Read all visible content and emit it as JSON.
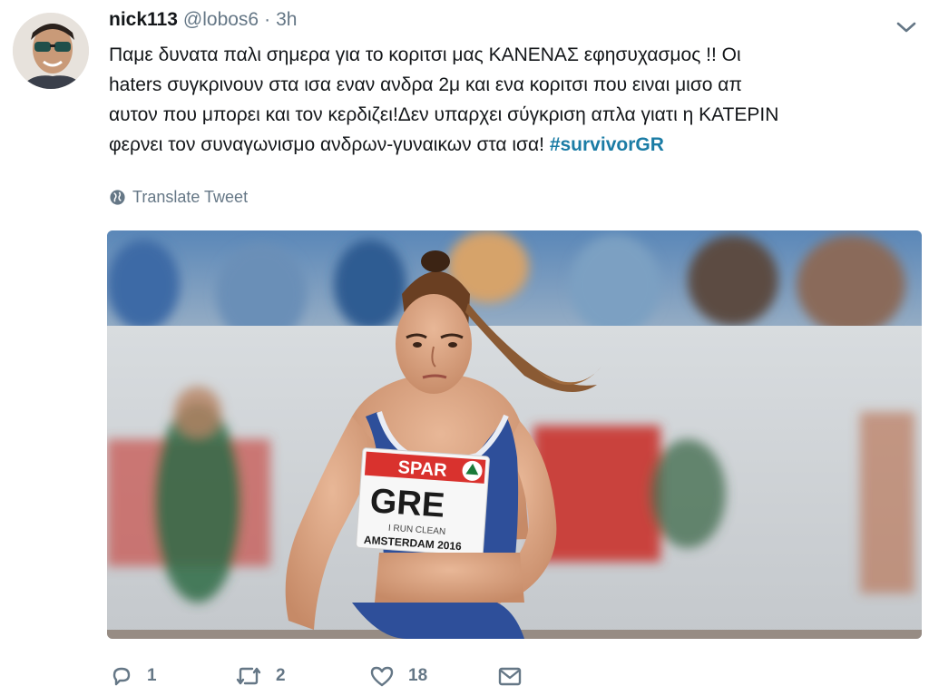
{
  "tweet": {
    "author_name": "nick113",
    "author_handle": "@lobos6",
    "separator": "·",
    "timestamp": "3h",
    "text_lines": [
      "Παμε δυνατα παλι σημερα για το κοριτσι μας ΚΑΝΕΝΑΣ εφησυχασμος !! Οι",
      "haters συγκρινουν στα ισα εναν ανδρα 2μ και ενα κοριτσι που ειναι μισο απ",
      "αυτον που μπορει και τον κερδιζει!Δεν υπαρχει σύγκριση απλα γιατι η ΚΑΤΕΡΙΝ",
      "φερνει τον συναγωνισμο ανδρων-γυναικων στα ισα! "
    ],
    "hashtag": "#survivorGR",
    "translate_label": "Translate Tweet",
    "translate_icon": "globe-icon",
    "caret_icon": "chevron-down-icon"
  },
  "photo": {
    "bib_sponsor": "SPAR",
    "bib_country": "GRE",
    "bib_slogan": "I RUN CLEAN",
    "bib_event": "AMSTERDAM 2016"
  },
  "actions": {
    "reply_count": "1",
    "retweet_count": "2",
    "like_count": "18",
    "reply_icon": "reply-icon",
    "retweet_icon": "retweet-icon",
    "like_icon": "heart-icon",
    "message_icon": "envelope-icon"
  },
  "colors": {
    "text": "#14171a",
    "muted": "#657786",
    "hashtag": "#1b7ca5"
  }
}
